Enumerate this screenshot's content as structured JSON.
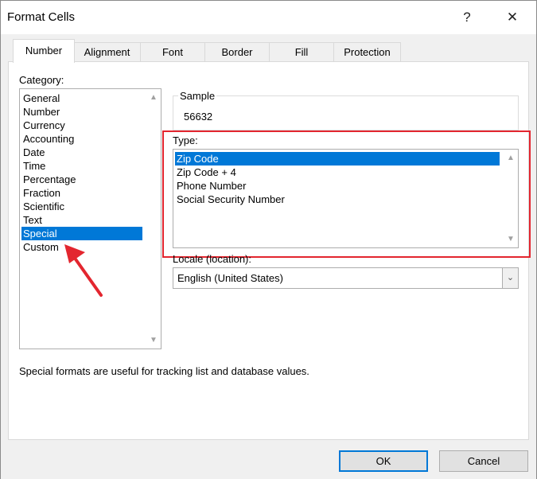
{
  "window": {
    "title": "Format Cells",
    "help_glyph": "?",
    "close_glyph": "✕"
  },
  "tabs": [
    {
      "label": "Number"
    },
    {
      "label": "Alignment"
    },
    {
      "label": "Font"
    },
    {
      "label": "Border"
    },
    {
      "label": "Fill"
    },
    {
      "label": "Protection"
    }
  ],
  "category": {
    "label": "Category:",
    "items": [
      "General",
      "Number",
      "Currency",
      "Accounting",
      "Date",
      "Time",
      "Percentage",
      "Fraction",
      "Scientific",
      "Text",
      "Special",
      "Custom"
    ],
    "selected": "Special"
  },
  "sample": {
    "label": "Sample",
    "value": "56632"
  },
  "type": {
    "label": "Type:",
    "items": [
      "Zip Code",
      "Zip Code + 4",
      "Phone Number",
      "Social Security Number"
    ],
    "selected": "Zip Code"
  },
  "locale": {
    "label": "Locale (location):",
    "value": "English (United States)"
  },
  "description": "Special formats are useful for tracking list and database values.",
  "buttons": {
    "ok": "OK",
    "cancel": "Cancel"
  },
  "colors": {
    "selection": "#0078d7",
    "highlight_box": "#e3262f",
    "arrow": "#e3262f"
  },
  "icons": {
    "scroll_up": "chevron-up-icon",
    "scroll_down": "chevron-down-icon",
    "dropdown": "chevron-down-icon"
  }
}
